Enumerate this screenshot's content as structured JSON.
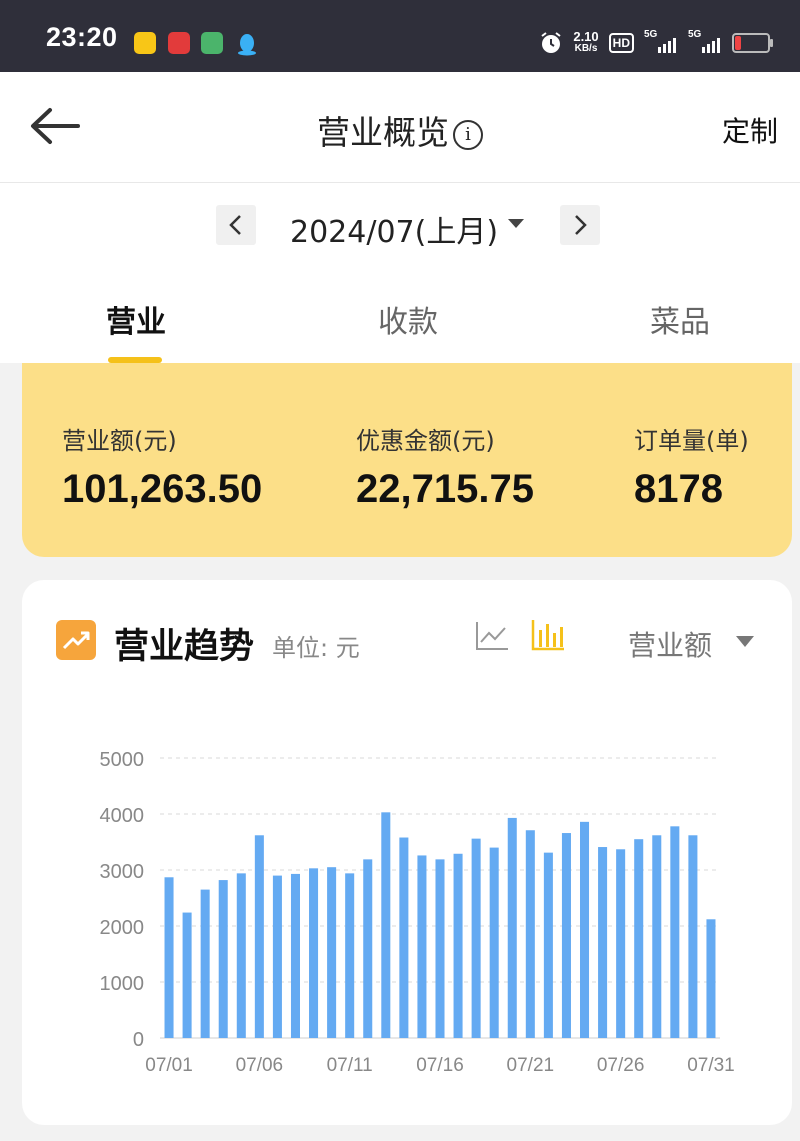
{
  "status_bar": {
    "time": "23:20",
    "net_speed": "2.10",
    "net_unit": "KB/s",
    "hd": "HD",
    "sim1": "5G",
    "sim2": "5G"
  },
  "header": {
    "title": "营业概览",
    "info_symbol": "i",
    "custom_label": "定制"
  },
  "date_selector": {
    "value": "2024/07(上月)"
  },
  "tabs": [
    {
      "label": "营业",
      "active": true
    },
    {
      "label": "收款",
      "active": false
    },
    {
      "label": "菜品",
      "active": false
    }
  ],
  "stats": [
    {
      "label": "营业额(元)",
      "value": "101,263.50"
    },
    {
      "label": "优惠金额(元)",
      "value": "22,715.75"
    },
    {
      "label": "订单量(单)",
      "value": "8178"
    }
  ],
  "chart_section": {
    "title": "营业趋势",
    "unit": "单位: 元",
    "metric": "营业额"
  },
  "colors": {
    "accent": "#f5c11a",
    "card": "#fcdf88",
    "bar": "#64aaf2",
    "trend_icon": "#f6a53c"
  },
  "chart_data": {
    "type": "bar",
    "categories": [
      "07/01",
      "07/02",
      "07/03",
      "07/04",
      "07/05",
      "07/06",
      "07/07",
      "07/08",
      "07/09",
      "07/10",
      "07/11",
      "07/12",
      "07/13",
      "07/14",
      "07/15",
      "07/16",
      "07/17",
      "07/18",
      "07/19",
      "07/20",
      "07/21",
      "07/22",
      "07/23",
      "07/24",
      "07/25",
      "07/26",
      "07/27",
      "07/28",
      "07/29",
      "07/30",
      "07/31"
    ],
    "tick_labels": [
      "07/01",
      "07/06",
      "07/11",
      "07/16",
      "07/21",
      "07/26",
      "07/31"
    ],
    "values": [
      2870,
      2240,
      2650,
      2820,
      2940,
      3620,
      2900,
      2930,
      3030,
      3050,
      2940,
      3190,
      4030,
      3580,
      3260,
      3190,
      3290,
      3560,
      3400,
      3930,
      3710,
      3310,
      3660,
      3860,
      3410,
      3370,
      3550,
      3620,
      3780,
      3620,
      2120
    ],
    "ylim": [
      0,
      5000
    ],
    "yticks": [
      0,
      1000,
      2000,
      3000,
      4000,
      5000
    ],
    "grid": true,
    "title": "",
    "xlabel": "",
    "ylabel": ""
  }
}
